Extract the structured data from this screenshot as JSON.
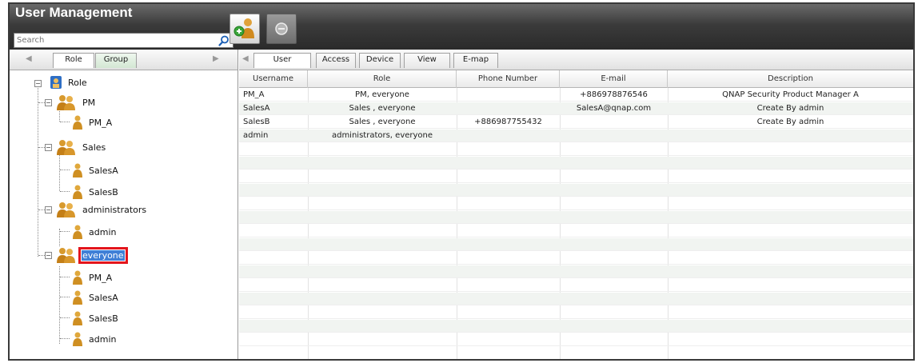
{
  "app": {
    "title": "User Management"
  },
  "search": {
    "placeholder": "Search"
  },
  "left_tabs": [
    "Role",
    "Group"
  ],
  "tree": {
    "root": "Role",
    "groups": [
      {
        "name": "PM",
        "members": [
          "PM_A"
        ]
      },
      {
        "name": "Sales",
        "members": [
          "SalesA",
          "SalesB"
        ]
      },
      {
        "name": "administrators",
        "members": [
          "admin"
        ]
      },
      {
        "name": "everyone",
        "members": [
          "PM_A",
          "SalesA",
          "SalesB",
          "admin"
        ],
        "selected": true
      }
    ]
  },
  "right_tabs": [
    "User",
    "Access",
    "Device",
    "View",
    "E-map"
  ],
  "table": {
    "columns": [
      "Username",
      "Role",
      "Phone Number",
      "E-mail",
      "Description"
    ],
    "rows": [
      [
        "PM_A",
        "PM, everyone",
        "",
        "+886978876546",
        "QNAP Security Product Manager A"
      ],
      [
        "SalesA",
        "Sales , everyone",
        "",
        "SalesA@qnap.com",
        "Create By admin"
      ],
      [
        "SalesB",
        "Sales , everyone",
        "+886987755432",
        "",
        "Create By admin"
      ],
      [
        "admin",
        "administrators, everyone",
        "",
        "",
        ""
      ]
    ]
  },
  "colors": {
    "header_dark": "#2a2a2a",
    "selection": "#3f7fd6",
    "highlight_box": "#e3151c"
  },
  "icons": [
    "search-icon",
    "add-user-icon",
    "delete-icon",
    "role-root-icon",
    "group-icon",
    "user-icon"
  ]
}
